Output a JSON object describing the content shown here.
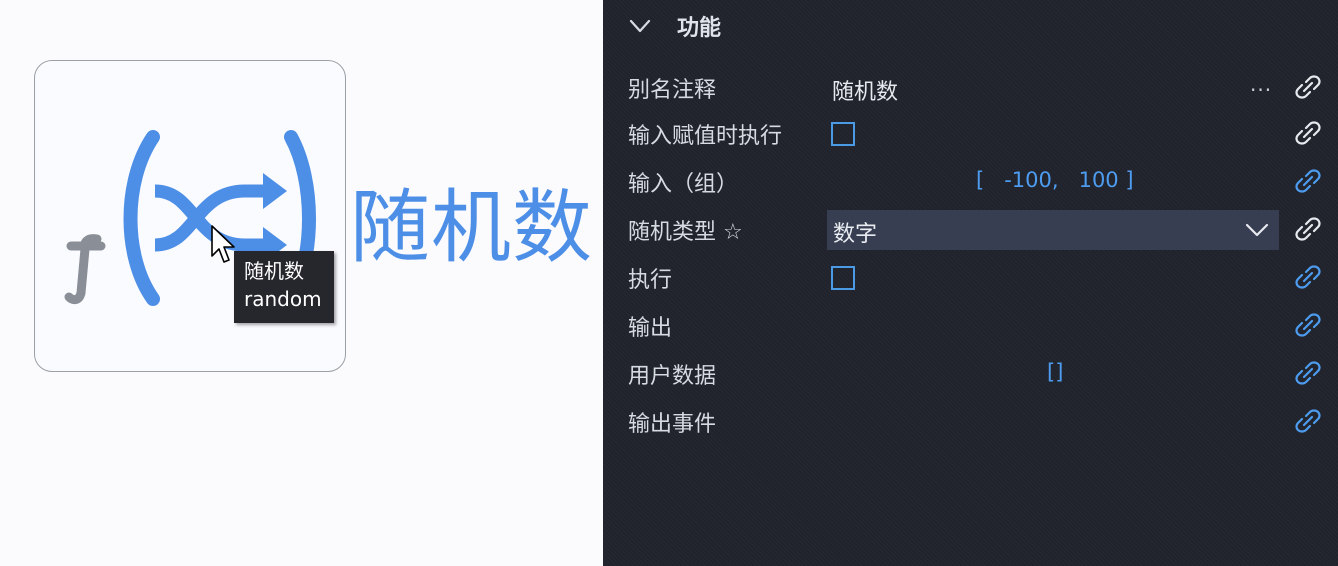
{
  "canvas": {
    "node_title": "随机数",
    "tooltip": {
      "line1": "随机数",
      "line2": "random"
    },
    "icon": "random-function-icon"
  },
  "panel": {
    "section_title": "功能",
    "rows": [
      {
        "label": "别名注释",
        "value": "随机数",
        "more": "...",
        "link_state": "inactive"
      },
      {
        "label": "输入赋值时执行",
        "checked": false,
        "link_state": "inactive"
      },
      {
        "label": "输入（组）",
        "range_text": "[   -100,   100 ]",
        "link_state": "active"
      },
      {
        "label": "随机类型 ☆",
        "selected": "数字",
        "link_state": "inactive"
      },
      {
        "label": "执行",
        "checked": false,
        "link_state": "active"
      },
      {
        "label": "输出",
        "link_state": "active"
      },
      {
        "label": "用户数据",
        "value": "[]",
        "link_state": "active"
      },
      {
        "label": "输出事件",
        "link_state": "active"
      }
    ]
  },
  "colors": {
    "accent_blue": "#4d9cf0",
    "panel_bg": "#20232b",
    "select_bg": "#383e52",
    "link_inactive": "#e6e9ee"
  }
}
